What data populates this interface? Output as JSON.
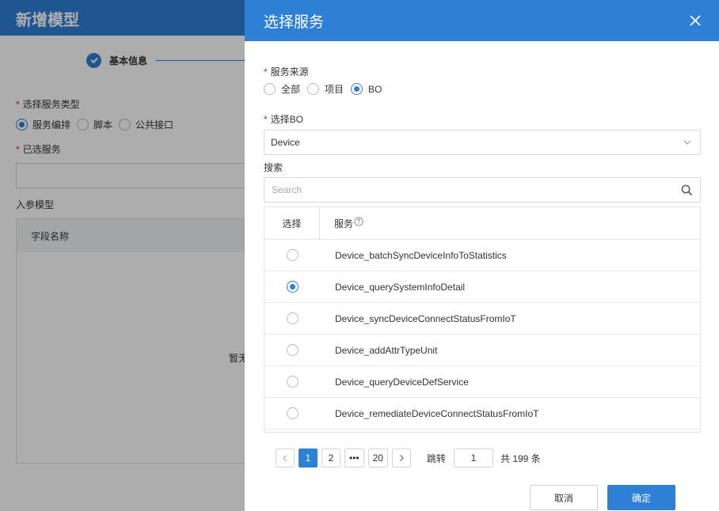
{
  "background": {
    "title": "新增模型",
    "step_label": "基本信息",
    "service_type_label": "选择服务类型",
    "service_type_options": [
      "服务编排",
      "脚本",
      "公共接口"
    ],
    "selected_service_label": "已选服务",
    "input_model_label": "入参模型",
    "table_col_field_name": "字段名称",
    "empty_text": "暂无"
  },
  "dialog": {
    "title": "选择服务",
    "source_label": "服务来源",
    "source_options": [
      "全部",
      "项目",
      "BO"
    ],
    "bo_label": "选择BO",
    "bo_value": "Device",
    "search_label": "搜索",
    "search_placeholder": "Search",
    "table": {
      "col_select": "选择",
      "col_service": "服务",
      "rows": [
        {
          "name": "Device_batchSyncDeviceInfoToStatistics",
          "selected": false
        },
        {
          "name": "Device_querySystemInfoDetail",
          "selected": true
        },
        {
          "name": "Device_syncDeviceConnectStatusFromIoT",
          "selected": false
        },
        {
          "name": "Device_addAttrTypeUnit",
          "selected": false
        },
        {
          "name": "Device_queryDeviceDefService",
          "selected": false
        },
        {
          "name": "Device_remediateDeviceConnectStatusFromIoT",
          "selected": false
        }
      ]
    },
    "pagination": {
      "pages": [
        "1",
        "2",
        "•••",
        "20"
      ],
      "current": "1",
      "jump_label": "跳转",
      "jump_value": "1",
      "total_text": "共 199 条"
    },
    "cancel_label": "取消",
    "ok_label": "确定"
  },
  "colors": {
    "primary": "#2e7fd6",
    "required": "#e02020"
  }
}
